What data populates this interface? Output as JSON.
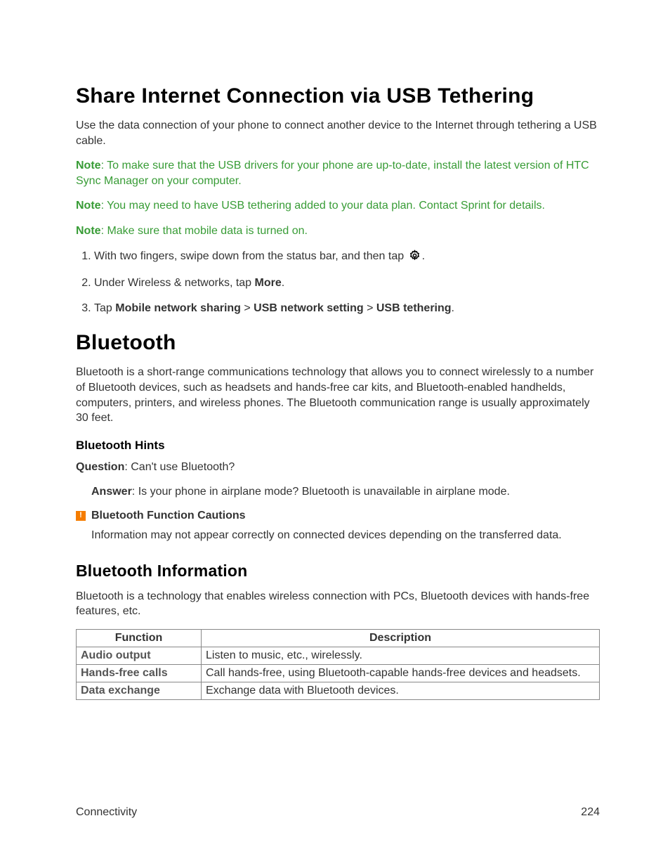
{
  "h1_share": "Share Internet Connection via USB Tethering",
  "p_share_intro": "Use the data connection of your phone to connect another device to the Internet through tethering a USB cable.",
  "notes": {
    "label": "Note",
    "n1_rest": ": To make sure that the USB drivers for your phone are up-to-date, install the latest version of HTC Sync Manager on your computer.",
    "n2_rest": ": You may need to have USB tethering added to your data plan. Contact Sprint for details.",
    "n3_rest": ": Make sure that mobile data is turned on."
  },
  "steps": {
    "s1_a": "With two fingers, swipe down from the status bar, and then tap ",
    "s1_b": ".",
    "s2_a": "Under Wireless & networks, tap ",
    "s2_bold": "More",
    "s2_b": ".",
    "s3_a": "Tap ",
    "s3_b1": "Mobile network sharing",
    "s3_gt1": " > ",
    "s3_b2": "USB network setting",
    "s3_gt2": " > ",
    "s3_b3": "USB tethering",
    "s3_end": "."
  },
  "h1_bt": "Bluetooth",
  "p_bt_intro": "Bluetooth is a short-range communications technology that allows you to connect wirelessly to a number of Bluetooth devices, such as headsets and hands-free car kits, and Bluetooth-enabled handhelds, computers, printers, and wireless phones. The Bluetooth communication range is usually approximately 30 feet.",
  "h3_hints": "Bluetooth Hints",
  "q_label": "Question",
  "q_rest": ": Can't use Bluetooth?",
  "a_label": "Answer",
  "a_rest": ": Is your phone in airplane mode? Bluetooth is unavailable in airplane mode.",
  "caution_title": "Bluetooth Function Cautions",
  "caution_body": "Information may not appear correctly on connected devices depending on the transferred data.",
  "h2_info": "Bluetooth Information",
  "p_info_intro": "Bluetooth is a technology that enables wireless connection with PCs, Bluetooth devices with hands-free features, etc.",
  "table": {
    "h_fn": "Function",
    "h_desc": "Description",
    "rows": [
      {
        "fn": "Audio output",
        "desc": "Listen to music, etc., wirelessly."
      },
      {
        "fn": "Hands-free calls",
        "desc": "Call hands-free, using Bluetooth-capable hands-free devices and headsets."
      },
      {
        "fn": "Data exchange",
        "desc": "Exchange data with Bluetooth devices."
      }
    ]
  },
  "footer": {
    "section": "Connectivity",
    "page": "224"
  }
}
